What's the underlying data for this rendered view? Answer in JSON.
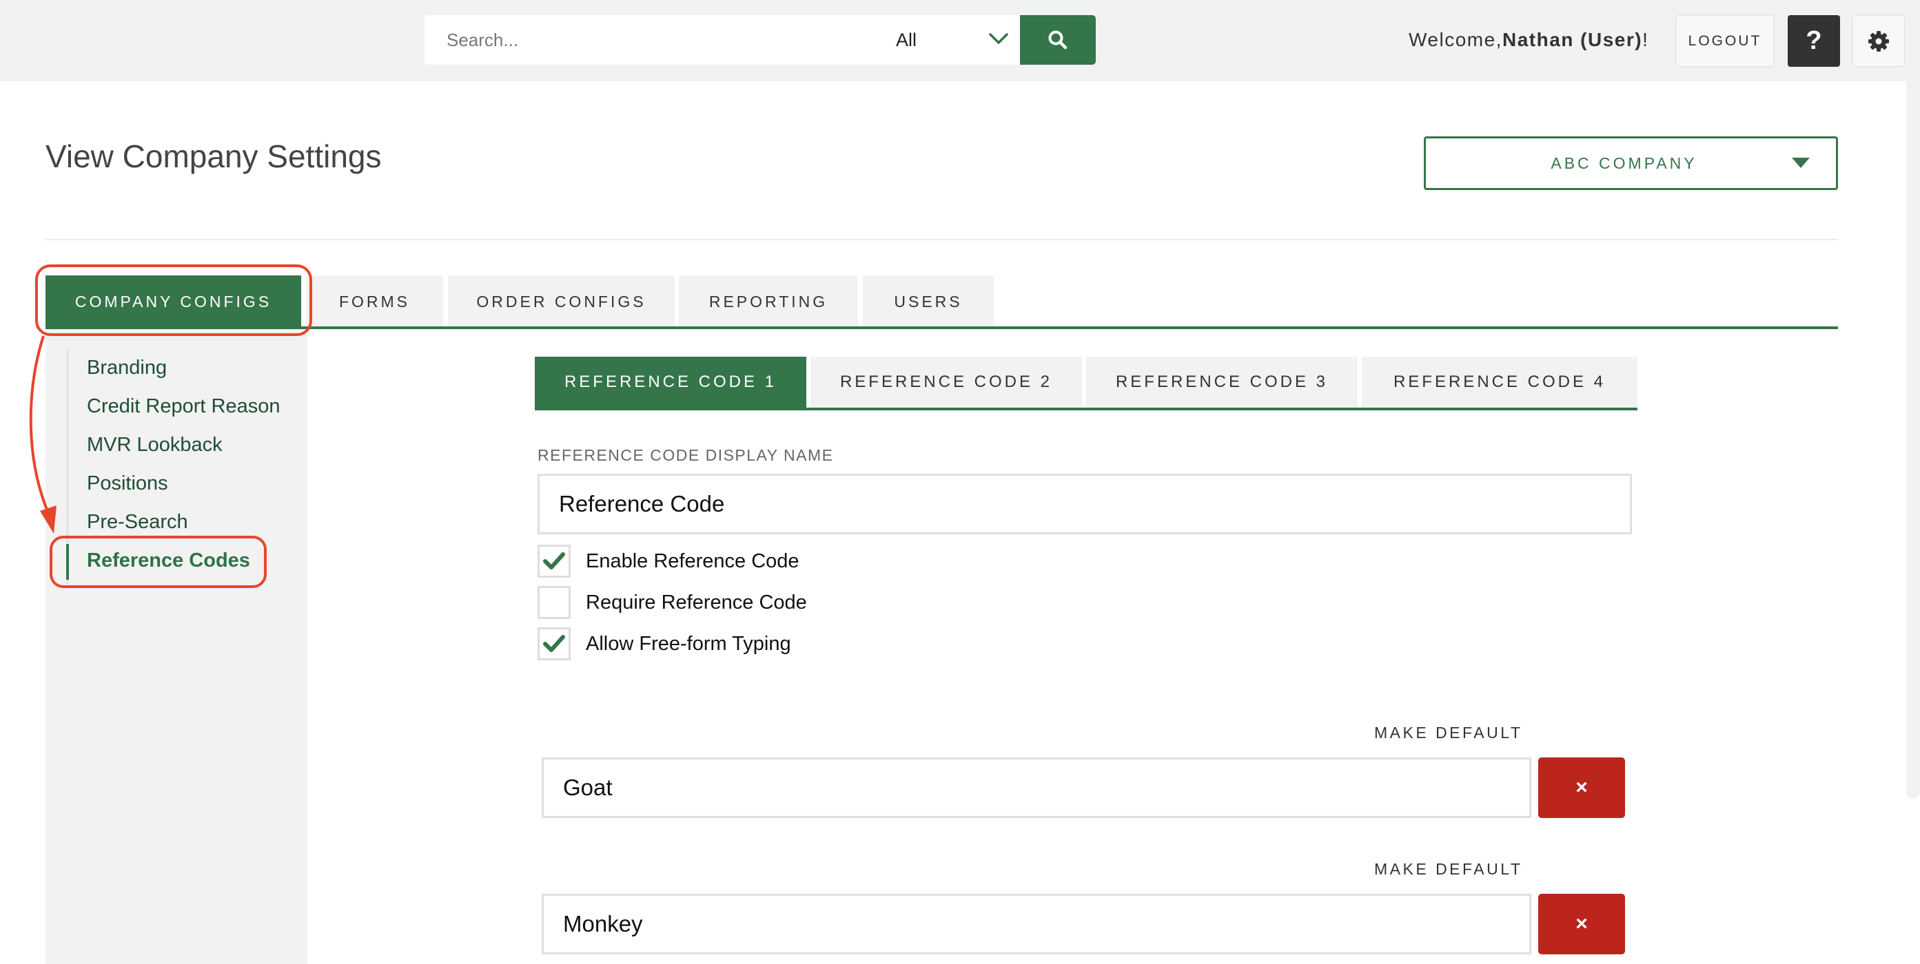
{
  "header": {
    "search_placeholder": "Search...",
    "search_value": "",
    "scope_selected": "All",
    "search_button_icon": "search-icon",
    "welcome_prefix": "Welcome,",
    "user_name": "Nathan (User)",
    "welcome_suffix": "!",
    "logout_label": "LOGOUT",
    "help_label": "?",
    "settings_icon": "gear-icon"
  },
  "page": {
    "title": "View Company Settings",
    "company_selected": "ABC COMPANY"
  },
  "main_tabs": [
    {
      "label": "COMPANY CONFIGS",
      "active": true
    },
    {
      "label": "FORMS",
      "active": false
    },
    {
      "label": "ORDER CONFIGS",
      "active": false
    },
    {
      "label": "REPORTING",
      "active": false
    },
    {
      "label": "USERS",
      "active": false
    }
  ],
  "sidebar": {
    "items": [
      {
        "label": "Branding",
        "active": false
      },
      {
        "label": "Credit Report Reason",
        "active": false
      },
      {
        "label": "MVR Lookback",
        "active": false
      },
      {
        "label": "Positions",
        "active": false
      },
      {
        "label": "Pre-Search",
        "active": false
      },
      {
        "label": "Reference Codes",
        "active": true
      }
    ]
  },
  "sub_tabs": [
    {
      "label": "REFERENCE CODE 1",
      "active": true
    },
    {
      "label": "REFERENCE CODE 2",
      "active": false
    },
    {
      "label": "REFERENCE CODE 3",
      "active": false
    },
    {
      "label": "REFERENCE CODE 4",
      "active": false
    }
  ],
  "form": {
    "display_name_label": "REFERENCE CODE DISPLAY NAME",
    "display_name_value": "Reference Code",
    "checkboxes": [
      {
        "label": "Enable Reference Code",
        "checked": true
      },
      {
        "label": "Require Reference Code",
        "checked": false
      },
      {
        "label": "Allow Free-form Typing",
        "checked": true
      }
    ],
    "codes": [
      {
        "make_default_label": "MAKE DEFAULT",
        "value": "Goat",
        "remove_label": "×"
      },
      {
        "make_default_label": "MAKE DEFAULT",
        "value": "Monkey",
        "remove_label": "×"
      }
    ]
  },
  "colors": {
    "brand_green": "#34754a",
    "danger_red": "#bb251c",
    "annotation_red": "#e8452b",
    "header_bg": "#f2f2f2"
  }
}
